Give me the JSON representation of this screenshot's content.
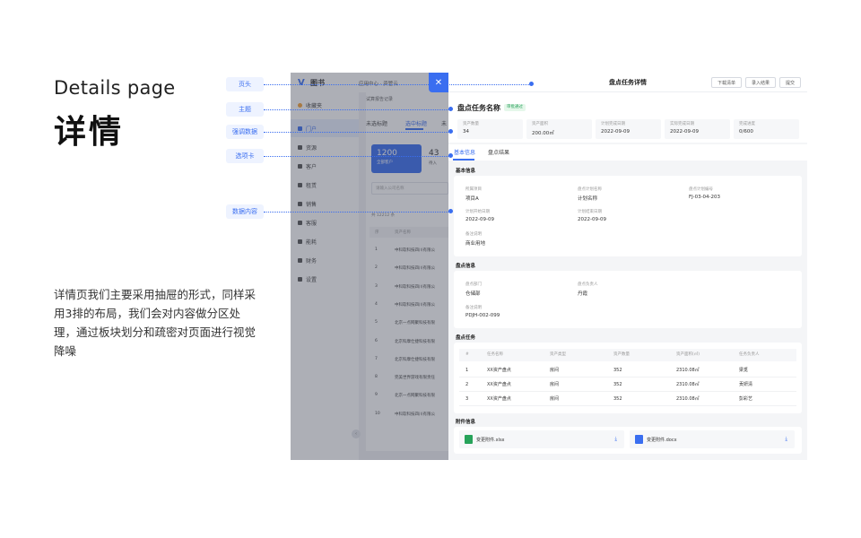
{
  "heading_en": "Details page",
  "heading_cn": "详情",
  "description": "详情页我们主要采用抽屉的形式，同样采用3排的布局，我们会对内容做分区处理，通过板块划分和疏密对页面进行视觉降噪",
  "annotations": [
    "页头",
    "主题",
    "强调数据",
    "选项卡",
    "数据内容"
  ],
  "bg_app": {
    "logo": "图书",
    "topbar": "应用中心 · 资管云",
    "sidebar": [
      "收藏夹",
      "门户",
      "资源",
      "客户",
      "租赁",
      "销售",
      "客服",
      "能耗",
      "财务",
      "设置"
    ],
    "panel_title": "试算报告记录",
    "panel_tabs": [
      "未选标题",
      "选中标题",
      "未"
    ],
    "stat_value": "1200",
    "stat_label": "全部客户",
    "stat_value2": "43",
    "stat_label2": "待入",
    "search_placeholder": "请输入公司名称",
    "count_text": "共 12212 条",
    "col_index": "序",
    "col_name": "资产名称",
    "rows": [
      {
        "n": "1",
        "name": "中科软科技四川有限公"
      },
      {
        "n": "2",
        "name": "中科软科技四川有限公"
      },
      {
        "n": "3",
        "name": "中科软科技四川有限公"
      },
      {
        "n": "4",
        "name": "中科软科技四川有限公"
      },
      {
        "n": "5",
        "name": "北京一点网聚科技有限"
      },
      {
        "n": "6",
        "name": "北京科摩仕捷科技有限"
      },
      {
        "n": "7",
        "name": "北京科摩仕捷科技有限"
      },
      {
        "n": "8",
        "name": "完美世界游戏有限责任"
      },
      {
        "n": "9",
        "name": "北京一点网聚科技有限"
      },
      {
        "n": "10",
        "name": "中科软科技四川有限公"
      }
    ]
  },
  "drawer": {
    "close": "✕",
    "title": "盘点任务详情",
    "buttons": [
      "下载清单",
      "录入结果",
      "提交"
    ],
    "subject": "盘点任务名称",
    "status": "审批通过",
    "stats": [
      {
        "label": "资产数量",
        "value": "34"
      },
      {
        "label": "资产面积",
        "value": "200.00㎡"
      },
      {
        "label": "计划完成日期",
        "value": "2022-09-09"
      },
      {
        "label": "实际完成日期",
        "value": "2022-09-09"
      },
      {
        "label": "完成进度",
        "value": "0/600"
      }
    ],
    "tabs": [
      "基本信息",
      "盘点结果"
    ],
    "sections": [
      "基本信息",
      "盘点信息",
      "盘点任务",
      "附件信息"
    ],
    "basic": [
      {
        "label": "所属项目",
        "value": "项目A"
      },
      {
        "label": "盘点计划名称",
        "value": "计划名称"
      },
      {
        "label": "盘点计划编号",
        "value": "FJ-03-04-203"
      },
      {
        "label": "计划开始日期",
        "value": "2022-09-09"
      },
      {
        "label": "计划结束日期",
        "value": "2022-09-09"
      },
      {
        "label": "备注说明",
        "value": "商业用地"
      }
    ],
    "inventory": [
      {
        "label": "盘点部门",
        "value": "仓储部"
      },
      {
        "label": "盘点负责人",
        "value": "丹霞"
      },
      {
        "label": "备注说明",
        "value": "PDJH-002-099"
      }
    ],
    "task_headers": [
      "#",
      "任务名称",
      "资产类型",
      "资产数量",
      "资产面积(㎡)",
      "任务负责人"
    ],
    "tasks": [
      [
        "1",
        "XX资产盘点",
        "房间",
        "352",
        "2310.08㎡",
        "梁觅"
      ],
      [
        "2",
        "XX资产盘点",
        "房间",
        "352",
        "2310.08㎡",
        "贡妍清"
      ],
      [
        "3",
        "XX资产盘点",
        "房间",
        "352",
        "2310.08㎡",
        "彭彩艺"
      ]
    ],
    "attachments": [
      {
        "name": "变更附件.xlsx",
        "color": "#27a35a"
      },
      {
        "name": "变更附件.docx",
        "color": "#3a6ef0"
      }
    ]
  },
  "colors": {
    "accent": "#3a6ef0",
    "success": "#26a05a"
  }
}
